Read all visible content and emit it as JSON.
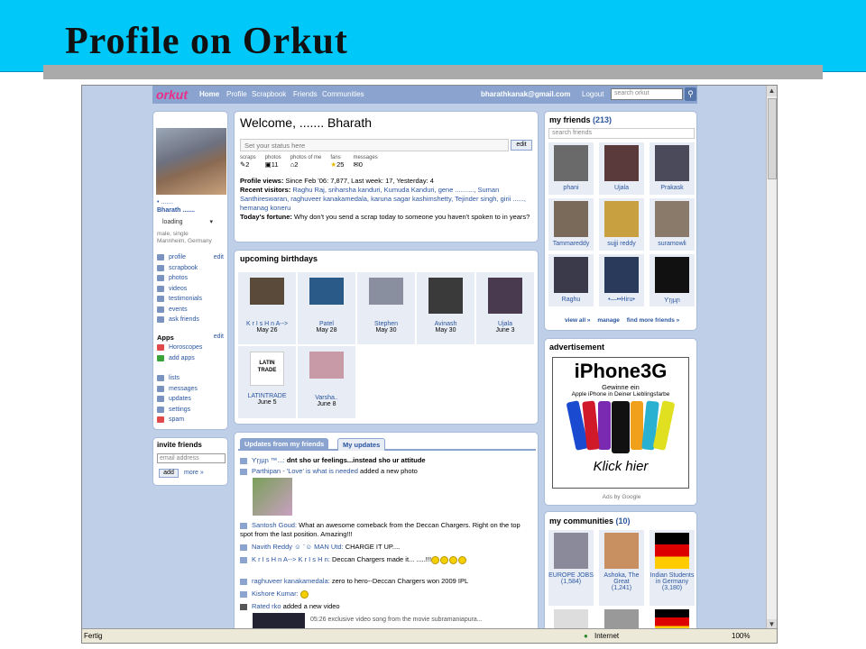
{
  "slide": {
    "title": "Profile on Orkut"
  },
  "topbar": {
    "logo": "orkut",
    "nav": [
      "Home",
      "Profile",
      "Scrapbook",
      "Friends",
      "Communities"
    ],
    "email": "bharathkanak@gmail.com",
    "logout": "Logout",
    "search_placeholder": "search orkut"
  },
  "left": {
    "name_line1": "• .......",
    "name_line2": "Bharath .......",
    "status_select": "loading",
    "info1": "male, single",
    "info2": "Mannheim, Germany",
    "menu": [
      "profile",
      "scrapbook",
      "photos",
      "videos",
      "testimonials",
      "events",
      "ask friends"
    ],
    "edit": "edit",
    "apps_title": "Apps",
    "apps_edit": "edit",
    "apps": [
      "Horoscopes",
      "add apps"
    ],
    "menu2": [
      "lists",
      "messages",
      "updates",
      "settings",
      "spam"
    ],
    "invite_title": "invite friends",
    "invite_placeholder": "email address",
    "invite_add": "add",
    "invite_more": "more »"
  },
  "welcome": {
    "title": "Welcome, ....... Bharath",
    "status_placeholder": "Set your status here",
    "status_edit": "edit",
    "stats": [
      {
        "label": "scraps",
        "value": "2"
      },
      {
        "label": "photos",
        "value": "11"
      },
      {
        "label": "photos of me",
        "value": "2"
      },
      {
        "label": "fans",
        "value": "25"
      },
      {
        "label": "messages",
        "value": "0"
      }
    ],
    "views_label": "Profile views:",
    "views_text": "Since Feb '06: 7,877, Last week: 17, Yesterday: 4",
    "visitors_label": "Recent visitors:",
    "visitors_text": "Raghu Raj, sriharsha kanduri, Kumuda Kanduri, gene .........., Suman Santhireswaran, raghuveer kanakamedala, karuna sagar kashimshetty, Tejinder singh, girii ......, hemanag koneru",
    "fortune_label": "Today's fortune:",
    "fortune_text": "Why don't you send a scrap today to someone you haven't spoken to in years?"
  },
  "birthdays": {
    "title": "upcoming birthdays",
    "items": [
      {
        "name": "K r I s H n A-->",
        "date": "May 26"
      },
      {
        "name": "Patel",
        "date": "May 28"
      },
      {
        "name": "Stephen",
        "date": "May 30"
      },
      {
        "name": "Avinash",
        "date": "May 30"
      },
      {
        "name": "Ujala",
        "date": "June 3"
      },
      {
        "name": "LATINTRADE",
        "date": "June 5"
      },
      {
        "name": "Varsha..",
        "date": "June 8"
      }
    ],
    "latin_logo": "LATIN TRADE"
  },
  "updates": {
    "tab1": "Updates from my friends",
    "tab2": "My updates",
    "items": [
      {
        "who": "Ƴŗյµɲ ™...:",
        "text": "dnt sho ur feelings...instead sho ur attitude"
      },
      {
        "who": "Parthipan - 'Love' is what is needed",
        "text": "added a new photo"
      },
      {
        "who": "Santosh Goud:",
        "text": "What an awesome comeback from the Deccan Chargers. Right on the top spot from the last position. Amazing!!!"
      },
      {
        "who": "Navith Reddy ☺ ¨☺ MAN Utd:",
        "text": "CHARGE IT UP...."
      },
      {
        "who": "K r I s H n A--> K r I s H n:",
        "text": "Deccan Chargers made it...  .....!!!"
      },
      {
        "who": "raghuveer kanakamedala:",
        "text": "zero to hero--Deccan Chargers won 2009 IPL"
      },
      {
        "who": "Kishore Kumar:",
        "text": ""
      },
      {
        "who": "Rated rko",
        "text": "added a new video"
      }
    ],
    "video_caption": "05:26 exclusive video song from the movie subramaniapura..."
  },
  "friends": {
    "title": "my friends",
    "count": "(213)",
    "search_placeholder": "search friends",
    "items": [
      "phani",
      "Ujala",
      "Prakask",
      "Tammareddy",
      "sujji reddy",
      "suramowli",
      "Raghu",
      "•—••Hiru•",
      "Ƴŗյµɲ"
    ],
    "view_all": "view all »",
    "manage": "manage",
    "find_more": "find more friends »"
  },
  "ad": {
    "title": "advertisement",
    "headline": "iPhone3G",
    "line1": "Gewinne ein",
    "line2": "Apple iPhone in Deiner Lieblingsfarbe",
    "cta": "Klick hier",
    "by": "Ads by Google"
  },
  "communities": {
    "title": "my communities",
    "count": "(10)",
    "items": [
      {
        "name": "EUROPE JOBS",
        "count": "(1,584)"
      },
      {
        "name": "Ashoka, The Great",
        "count": "(1,241)"
      },
      {
        "name": "Indian Students in Germany",
        "count": "(3,180)"
      }
    ]
  },
  "status": {
    "left": "Fertig",
    "zone": "Internet",
    "zoom": "100%"
  },
  "colors": {
    "slide_bg": "#00c8f8",
    "orkut_blue": "#8aa4cf",
    "link": "#2a55a0",
    "orkut_pink": "#e8308a"
  }
}
